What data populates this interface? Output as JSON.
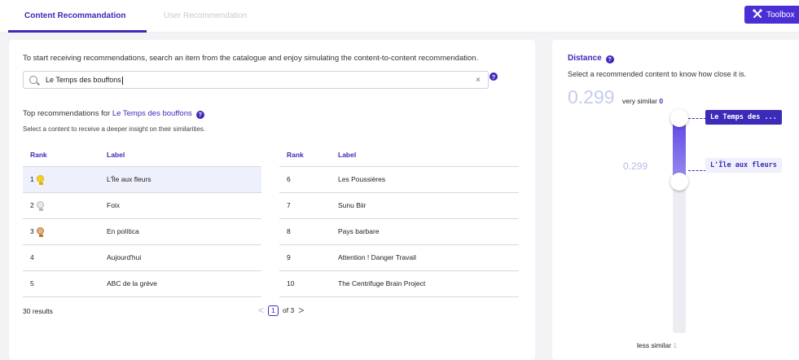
{
  "tabs": [
    {
      "label": "Content Recommandation",
      "active": true
    },
    {
      "label": "User Recommendation",
      "active": false
    }
  ],
  "toolbox": {
    "label": "Toolbox",
    "icon": "tools-icon"
  },
  "left": {
    "intro": "To start receiving recommendations, search an item from the catalogue and enjoy simulating the content-to-content recommendation.",
    "search": {
      "value": "Le Temps des bouffons",
      "icon": "search-icon",
      "clear": "×"
    },
    "help_glyph": "?",
    "top_prefix": "Top recommendations for",
    "top_item": "Le Temps des bouffons",
    "subtext": "Select a content to receive a deeper insight on their similarities.",
    "headers": {
      "rank": "Rank",
      "label": "Label"
    },
    "table1": [
      {
        "rank": "1",
        "label": "L'Île aux fleurs",
        "medal": "gold"
      },
      {
        "rank": "2",
        "label": "Foix",
        "medal": "silver"
      },
      {
        "rank": "3",
        "label": "En política",
        "medal": "bronze"
      },
      {
        "rank": "4",
        "label": "Aujourd'hui",
        "medal": ""
      },
      {
        "rank": "5",
        "label": "ABC de la grève",
        "medal": ""
      }
    ],
    "table2": [
      {
        "rank": "6",
        "label": "Les Poussières"
      },
      {
        "rank": "7",
        "label": "Sunu Biir"
      },
      {
        "rank": "8",
        "label": "Pays barbare"
      },
      {
        "rank": "9",
        "label": "Attention ! Danger Travail"
      },
      {
        "rank": "10",
        "label": "The Centrifuge Brain Project"
      }
    ],
    "results": "30 results",
    "pagination": {
      "prev": "<",
      "current": "1",
      "of": "of 3",
      "next": ">"
    }
  },
  "right": {
    "title": "Distance",
    "subtitle": "Select a recommended content to know how close it is.",
    "big_value": "0.299",
    "very_similar_label": "very similar",
    "very_similar_value": "0",
    "mid_value": "0.299",
    "tag_top": "Le Temps des ...",
    "tag_bottom": "L'Île aux fleurs",
    "less_similar_label": "less similar",
    "less_similar_value": "1",
    "distance_level": 0.299
  },
  "colors": {
    "accent": "#3b2bb8",
    "toolbox_bg": "#4b2fd6"
  }
}
